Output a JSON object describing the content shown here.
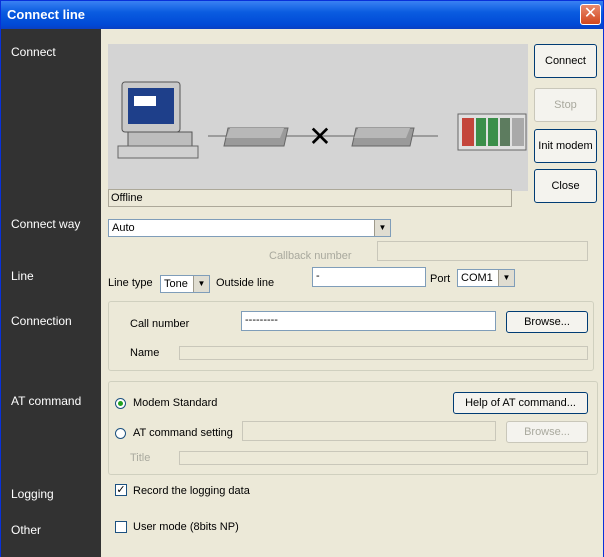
{
  "window": {
    "title": "Connect line",
    "close_glyph": "✕"
  },
  "sidebar": {
    "items": [
      {
        "label": "Connect"
      },
      {
        "label": "Connect way"
      },
      {
        "label": "Line"
      },
      {
        "label": "Connection"
      },
      {
        "label": "AT command"
      },
      {
        "label": "Logging"
      },
      {
        "label": "Other"
      }
    ]
  },
  "buttons": {
    "connect": "Connect",
    "stop": "Stop",
    "init_modem": "Init modem",
    "close": "Close",
    "browse_call": "Browse...",
    "help_at": "Help of AT command...",
    "browse_at": "Browse..."
  },
  "diagram": {
    "status_glyph": "✕"
  },
  "status": {
    "text": "Offline"
  },
  "connect_way": {
    "selected": "Auto",
    "callback_label": "Callback number",
    "callback_value": ""
  },
  "line": {
    "line_type_label": "Line type",
    "line_type_value": "Tone",
    "outside_line_label": "Outside line",
    "outside_line_value": "-",
    "port_label": "Port",
    "port_value": "COM1"
  },
  "connection": {
    "call_number_label": "Call number",
    "call_number_value": "---------",
    "name_label": "Name",
    "name_value": ""
  },
  "at_command": {
    "modem_standard_label": "Modem Standard",
    "at_setting_label": "AT command setting",
    "at_setting_value": "",
    "title_label": "Title",
    "title_value": ""
  },
  "logging": {
    "record_label": "Record the logging data",
    "checked_glyph": "✓"
  },
  "other": {
    "user_mode_label": "User mode (8bits NP)"
  },
  "colors": {
    "sidebar_bg": "#323232",
    "titlebar": "#0a5ce0",
    "diagram_bg": "#d4d4d4"
  }
}
